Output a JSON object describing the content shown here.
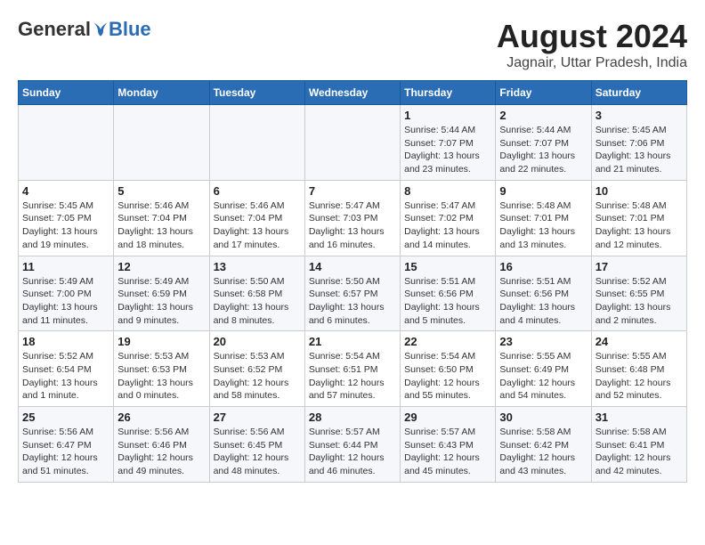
{
  "header": {
    "logo_general": "General",
    "logo_blue": "Blue",
    "month_title": "August 2024",
    "location": "Jagnair, Uttar Pradesh, India"
  },
  "columns": [
    "Sunday",
    "Monday",
    "Tuesday",
    "Wednesday",
    "Thursday",
    "Friday",
    "Saturday"
  ],
  "weeks": [
    [
      {
        "day": "",
        "info": ""
      },
      {
        "day": "",
        "info": ""
      },
      {
        "day": "",
        "info": ""
      },
      {
        "day": "",
        "info": ""
      },
      {
        "day": "1",
        "info": "Sunrise: 5:44 AM\nSunset: 7:07 PM\nDaylight: 13 hours\nand 23 minutes."
      },
      {
        "day": "2",
        "info": "Sunrise: 5:44 AM\nSunset: 7:07 PM\nDaylight: 13 hours\nand 22 minutes."
      },
      {
        "day": "3",
        "info": "Sunrise: 5:45 AM\nSunset: 7:06 PM\nDaylight: 13 hours\nand 21 minutes."
      }
    ],
    [
      {
        "day": "4",
        "info": "Sunrise: 5:45 AM\nSunset: 7:05 PM\nDaylight: 13 hours\nand 19 minutes."
      },
      {
        "day": "5",
        "info": "Sunrise: 5:46 AM\nSunset: 7:04 PM\nDaylight: 13 hours\nand 18 minutes."
      },
      {
        "day": "6",
        "info": "Sunrise: 5:46 AM\nSunset: 7:04 PM\nDaylight: 13 hours\nand 17 minutes."
      },
      {
        "day": "7",
        "info": "Sunrise: 5:47 AM\nSunset: 7:03 PM\nDaylight: 13 hours\nand 16 minutes."
      },
      {
        "day": "8",
        "info": "Sunrise: 5:47 AM\nSunset: 7:02 PM\nDaylight: 13 hours\nand 14 minutes."
      },
      {
        "day": "9",
        "info": "Sunrise: 5:48 AM\nSunset: 7:01 PM\nDaylight: 13 hours\nand 13 minutes."
      },
      {
        "day": "10",
        "info": "Sunrise: 5:48 AM\nSunset: 7:01 PM\nDaylight: 13 hours\nand 12 minutes."
      }
    ],
    [
      {
        "day": "11",
        "info": "Sunrise: 5:49 AM\nSunset: 7:00 PM\nDaylight: 13 hours\nand 11 minutes."
      },
      {
        "day": "12",
        "info": "Sunrise: 5:49 AM\nSunset: 6:59 PM\nDaylight: 13 hours\nand 9 minutes."
      },
      {
        "day": "13",
        "info": "Sunrise: 5:50 AM\nSunset: 6:58 PM\nDaylight: 13 hours\nand 8 minutes."
      },
      {
        "day": "14",
        "info": "Sunrise: 5:50 AM\nSunset: 6:57 PM\nDaylight: 13 hours\nand 6 minutes."
      },
      {
        "day": "15",
        "info": "Sunrise: 5:51 AM\nSunset: 6:56 PM\nDaylight: 13 hours\nand 5 minutes."
      },
      {
        "day": "16",
        "info": "Sunrise: 5:51 AM\nSunset: 6:56 PM\nDaylight: 13 hours\nand 4 minutes."
      },
      {
        "day": "17",
        "info": "Sunrise: 5:52 AM\nSunset: 6:55 PM\nDaylight: 13 hours\nand 2 minutes."
      }
    ],
    [
      {
        "day": "18",
        "info": "Sunrise: 5:52 AM\nSunset: 6:54 PM\nDaylight: 13 hours\nand 1 minute."
      },
      {
        "day": "19",
        "info": "Sunrise: 5:53 AM\nSunset: 6:53 PM\nDaylight: 13 hours\nand 0 minutes."
      },
      {
        "day": "20",
        "info": "Sunrise: 5:53 AM\nSunset: 6:52 PM\nDaylight: 12 hours\nand 58 minutes."
      },
      {
        "day": "21",
        "info": "Sunrise: 5:54 AM\nSunset: 6:51 PM\nDaylight: 12 hours\nand 57 minutes."
      },
      {
        "day": "22",
        "info": "Sunrise: 5:54 AM\nSunset: 6:50 PM\nDaylight: 12 hours\nand 55 minutes."
      },
      {
        "day": "23",
        "info": "Sunrise: 5:55 AM\nSunset: 6:49 PM\nDaylight: 12 hours\nand 54 minutes."
      },
      {
        "day": "24",
        "info": "Sunrise: 5:55 AM\nSunset: 6:48 PM\nDaylight: 12 hours\nand 52 minutes."
      }
    ],
    [
      {
        "day": "25",
        "info": "Sunrise: 5:56 AM\nSunset: 6:47 PM\nDaylight: 12 hours\nand 51 minutes."
      },
      {
        "day": "26",
        "info": "Sunrise: 5:56 AM\nSunset: 6:46 PM\nDaylight: 12 hours\nand 49 minutes."
      },
      {
        "day": "27",
        "info": "Sunrise: 5:56 AM\nSunset: 6:45 PM\nDaylight: 12 hours\nand 48 minutes."
      },
      {
        "day": "28",
        "info": "Sunrise: 5:57 AM\nSunset: 6:44 PM\nDaylight: 12 hours\nand 46 minutes."
      },
      {
        "day": "29",
        "info": "Sunrise: 5:57 AM\nSunset: 6:43 PM\nDaylight: 12 hours\nand 45 minutes."
      },
      {
        "day": "30",
        "info": "Sunrise: 5:58 AM\nSunset: 6:42 PM\nDaylight: 12 hours\nand 43 minutes."
      },
      {
        "day": "31",
        "info": "Sunrise: 5:58 AM\nSunset: 6:41 PM\nDaylight: 12 hours\nand 42 minutes."
      }
    ]
  ]
}
